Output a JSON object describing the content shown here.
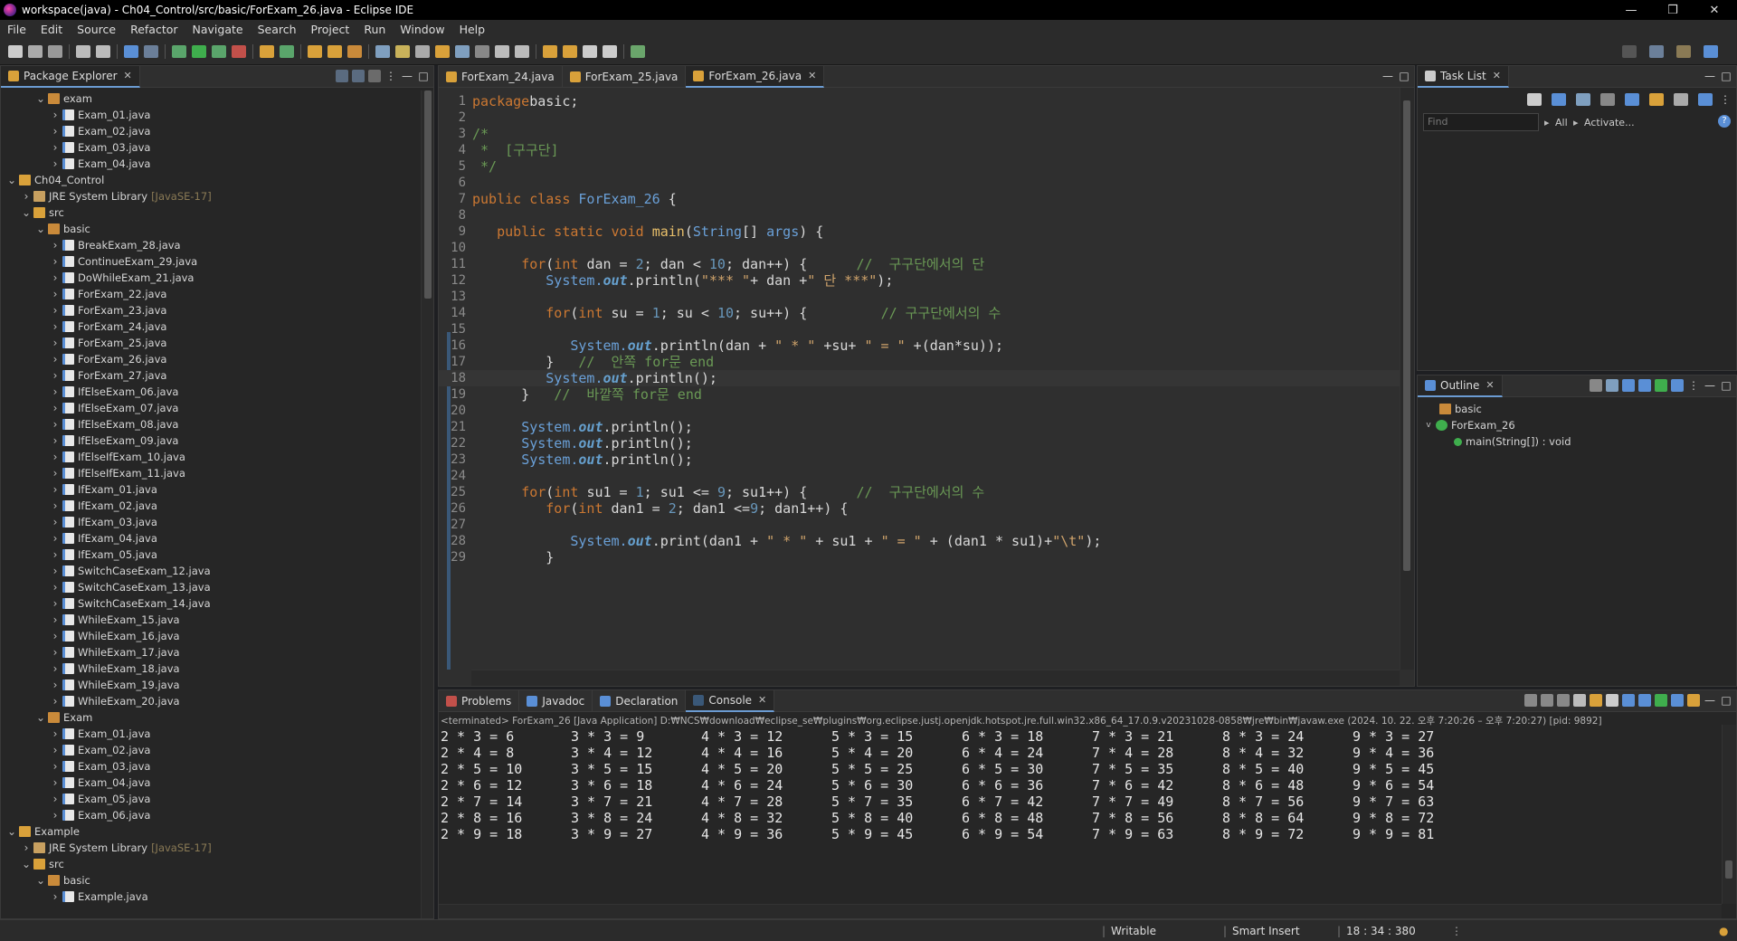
{
  "window": {
    "title": "workspace(java) - Ch04_Control/src/basic/ForExam_26.java - Eclipse IDE"
  },
  "menu": [
    "File",
    "Edit",
    "Source",
    "Refactor",
    "Navigate",
    "Search",
    "Project",
    "Run",
    "Window",
    "Help"
  ],
  "package_explorer": {
    "title": "Package Explorer",
    "rows": [
      {
        "d": 2,
        "ch": "v",
        "i": "pkg",
        "t": "exam"
      },
      {
        "d": 3,
        "ch": ">",
        "i": "java",
        "t": "Exam_01.java"
      },
      {
        "d": 3,
        "ch": ">",
        "i": "java",
        "t": "Exam_02.java"
      },
      {
        "d": 3,
        "ch": ">",
        "i": "java",
        "t": "Exam_03.java"
      },
      {
        "d": 3,
        "ch": ">",
        "i": "java",
        "t": "Exam_04.java"
      },
      {
        "d": 0,
        "ch": "v",
        "i": "proj",
        "t": "Ch04_Control"
      },
      {
        "d": 1,
        "ch": ">",
        "i": "jre",
        "t": "JRE System Library",
        "dec": "[JavaSE-17]"
      },
      {
        "d": 1,
        "ch": "v",
        "i": "src",
        "t": "src"
      },
      {
        "d": 2,
        "ch": "v",
        "i": "pkg",
        "t": "basic"
      },
      {
        "d": 3,
        "ch": ">",
        "i": "java",
        "t": "BreakExam_28.java"
      },
      {
        "d": 3,
        "ch": ">",
        "i": "java",
        "t": "ContinueExam_29.java"
      },
      {
        "d": 3,
        "ch": ">",
        "i": "java",
        "t": "DoWhileExam_21.java"
      },
      {
        "d": 3,
        "ch": ">",
        "i": "java",
        "t": "ForExam_22.java"
      },
      {
        "d": 3,
        "ch": ">",
        "i": "java",
        "t": "ForExam_23.java"
      },
      {
        "d": 3,
        "ch": ">",
        "i": "java",
        "t": "ForExam_24.java"
      },
      {
        "d": 3,
        "ch": ">",
        "i": "java",
        "t": "ForExam_25.java"
      },
      {
        "d": 3,
        "ch": ">",
        "i": "java",
        "t": "ForExam_26.java"
      },
      {
        "d": 3,
        "ch": ">",
        "i": "java",
        "t": "ForExam_27.java"
      },
      {
        "d": 3,
        "ch": ">",
        "i": "java",
        "t": "IfElseExam_06.java"
      },
      {
        "d": 3,
        "ch": ">",
        "i": "java",
        "t": "IfElseExam_07.java"
      },
      {
        "d": 3,
        "ch": ">",
        "i": "java",
        "t": "IfElseExam_08.java"
      },
      {
        "d": 3,
        "ch": ">",
        "i": "java",
        "t": "IfElseExam_09.java"
      },
      {
        "d": 3,
        "ch": ">",
        "i": "java",
        "t": "IfElseIfExam_10.java"
      },
      {
        "d": 3,
        "ch": ">",
        "i": "java",
        "t": "IfElseIfExam_11.java"
      },
      {
        "d": 3,
        "ch": ">",
        "i": "java",
        "t": "IfExam_01.java"
      },
      {
        "d": 3,
        "ch": ">",
        "i": "java",
        "t": "IfExam_02.java"
      },
      {
        "d": 3,
        "ch": ">",
        "i": "java",
        "t": "IfExam_03.java"
      },
      {
        "d": 3,
        "ch": ">",
        "i": "java",
        "t": "IfExam_04.java"
      },
      {
        "d": 3,
        "ch": ">",
        "i": "java",
        "t": "IfExam_05.java"
      },
      {
        "d": 3,
        "ch": ">",
        "i": "java",
        "t": "SwitchCaseExam_12.java"
      },
      {
        "d": 3,
        "ch": ">",
        "i": "java",
        "t": "SwitchCaseExam_13.java"
      },
      {
        "d": 3,
        "ch": ">",
        "i": "java",
        "t": "SwitchCaseExam_14.java"
      },
      {
        "d": 3,
        "ch": ">",
        "i": "java",
        "t": "WhileExam_15.java"
      },
      {
        "d": 3,
        "ch": ">",
        "i": "java",
        "t": "WhileExam_16.java"
      },
      {
        "d": 3,
        "ch": ">",
        "i": "java",
        "t": "WhileExam_17.java"
      },
      {
        "d": 3,
        "ch": ">",
        "i": "java",
        "t": "WhileExam_18.java"
      },
      {
        "d": 3,
        "ch": ">",
        "i": "java",
        "t": "WhileExam_19.java"
      },
      {
        "d": 3,
        "ch": ">",
        "i": "java",
        "t": "WhileExam_20.java"
      },
      {
        "d": 2,
        "ch": "v",
        "i": "pkg",
        "t": "Exam"
      },
      {
        "d": 3,
        "ch": ">",
        "i": "java",
        "t": "Exam_01.java"
      },
      {
        "d": 3,
        "ch": ">",
        "i": "java",
        "t": "Exam_02.java"
      },
      {
        "d": 3,
        "ch": ">",
        "i": "java",
        "t": "Exam_03.java"
      },
      {
        "d": 3,
        "ch": ">",
        "i": "java",
        "t": "Exam_04.java"
      },
      {
        "d": 3,
        "ch": ">",
        "i": "java",
        "t": "Exam_05.java"
      },
      {
        "d": 3,
        "ch": ">",
        "i": "java",
        "t": "Exam_06.java"
      },
      {
        "d": 0,
        "ch": "v",
        "i": "proj",
        "t": "Example"
      },
      {
        "d": 1,
        "ch": ">",
        "i": "jre",
        "t": "JRE System Library",
        "dec": "[JavaSE-17]"
      },
      {
        "d": 1,
        "ch": "v",
        "i": "src",
        "t": "src"
      },
      {
        "d": 2,
        "ch": "v",
        "i": "pkg",
        "t": "basic"
      },
      {
        "d": 3,
        "ch": ">",
        "i": "java",
        "t": "Example.java"
      }
    ]
  },
  "editor": {
    "tabs": [
      {
        "label": "ForExam_24.java",
        "active": false
      },
      {
        "label": "ForExam_25.java",
        "active": false
      },
      {
        "label": "ForExam_26.java",
        "active": true
      }
    ],
    "lines": [
      [
        [
          "kw",
          "package"
        ],
        [
          "",
          "basic;"
        ]
      ],
      [],
      [
        [
          "cmt",
          "/*"
        ]
      ],
      [
        [
          "cmt",
          " *  [구구단]"
        ]
      ],
      [
        [
          "cmt",
          " */"
        ]
      ],
      [],
      [
        [
          "kw",
          "public class "
        ],
        [
          "typ",
          "ForExam_26"
        ],
        [
          "",
          " {"
        ]
      ],
      [],
      [
        [
          "",
          "   "
        ],
        [
          "kw",
          "public static void "
        ],
        [
          "mth",
          "main"
        ],
        [
          "",
          "("
        ],
        [
          "typ",
          "String"
        ],
        [
          "",
          "[] "
        ],
        [
          "typ",
          "args"
        ],
        [
          "",
          ") {"
        ]
      ],
      [],
      [
        [
          "",
          "      "
        ],
        [
          "kw",
          "for"
        ],
        [
          "",
          "("
        ],
        [
          "kw",
          "int "
        ],
        [
          "",
          "dan = "
        ],
        [
          "num",
          "2"
        ],
        [
          "",
          "; dan < "
        ],
        [
          "num",
          "10"
        ],
        [
          "",
          "; dan++) {      "
        ],
        [
          "cmt",
          "//  구구단에서의 단"
        ]
      ],
      [
        [
          "",
          "         "
        ],
        [
          "sysc",
          "System."
        ],
        [
          "fld",
          "out"
        ],
        [
          "",
          ".println("
        ],
        [
          "str",
          "\"*** \""
        ],
        [
          "",
          "+ dan +"
        ],
        [
          "str",
          "\" 단 ***\""
        ],
        [
          "",
          ");"
        ]
      ],
      [],
      [
        [
          "",
          "         "
        ],
        [
          "kw",
          "for"
        ],
        [
          "",
          "("
        ],
        [
          "kw",
          "int "
        ],
        [
          "",
          "su = "
        ],
        [
          "num",
          "1"
        ],
        [
          "",
          "; su < "
        ],
        [
          "num",
          "10"
        ],
        [
          "",
          "; su++) {         "
        ],
        [
          "cmt",
          "// 구구단에서의 수"
        ]
      ],
      [],
      [
        [
          "",
          "            "
        ],
        [
          "sysc",
          "System."
        ],
        [
          "fld",
          "out"
        ],
        [
          "",
          ".println(dan + "
        ],
        [
          "str",
          "\" * \""
        ],
        [
          "",
          " +su+ "
        ],
        [
          "str",
          "\" = \""
        ],
        [
          "",
          " +(dan*su));"
        ]
      ],
      [
        [
          "",
          "         }   "
        ],
        [
          "cmt",
          "//  안쪽 for문 end"
        ]
      ],
      [
        [
          "",
          "         "
        ],
        [
          "sysc",
          "System."
        ],
        [
          "fld",
          "out"
        ],
        [
          "",
          ".println();"
        ]
      ],
      [
        [
          "",
          "      }   "
        ],
        [
          "cmt",
          "//  바깥쪽 for문 end"
        ]
      ],
      [],
      [
        [
          "",
          "      "
        ],
        [
          "sysc",
          "System."
        ],
        [
          "fld",
          "out"
        ],
        [
          "",
          ".println();"
        ]
      ],
      [
        [
          "",
          "      "
        ],
        [
          "sysc",
          "System."
        ],
        [
          "fld",
          "out"
        ],
        [
          "",
          ".println();"
        ]
      ],
      [
        [
          "",
          "      "
        ],
        [
          "sysc",
          "System."
        ],
        [
          "fld",
          "out"
        ],
        [
          "",
          ".println();"
        ]
      ],
      [],
      [
        [
          "",
          "      "
        ],
        [
          "kw",
          "for"
        ],
        [
          "",
          "("
        ],
        [
          "kw",
          "int "
        ],
        [
          "",
          "su1 = "
        ],
        [
          "num",
          "1"
        ],
        [
          "",
          "; su1 <= "
        ],
        [
          "num",
          "9"
        ],
        [
          "",
          "; su1++) {      "
        ],
        [
          "cmt",
          "//  구구단에서의 수"
        ]
      ],
      [
        [
          "",
          "         "
        ],
        [
          "kw",
          "for"
        ],
        [
          "",
          "("
        ],
        [
          "kw",
          "int "
        ],
        [
          "",
          "dan1 = "
        ],
        [
          "num",
          "2"
        ],
        [
          "",
          "; dan1 <="
        ],
        [
          "num",
          "9"
        ],
        [
          "",
          "; dan1++) {"
        ]
      ],
      [],
      [
        [
          "",
          "            "
        ],
        [
          "sysc",
          "System."
        ],
        [
          "fld",
          "out"
        ],
        [
          "",
          ".print(dan1 + "
        ],
        [
          "str",
          "\" * \""
        ],
        [
          "",
          " + su1 + "
        ],
        [
          "str",
          "\" = \""
        ],
        [
          "",
          " + (dan1 * su1)+"
        ],
        [
          "str",
          "\"\\t\""
        ],
        [
          "",
          ");"
        ]
      ],
      [
        [
          "",
          "         }"
        ]
      ]
    ]
  },
  "task_list": {
    "title": "Task List",
    "find_placeholder": "Find",
    "all_label": "All",
    "activate_label": "Activate..."
  },
  "outline": {
    "title": "Outline",
    "items": [
      "basic",
      "ForExam_26",
      "main(String[]) : void"
    ]
  },
  "bottom_tabs": [
    {
      "label": "Problems",
      "active": false
    },
    {
      "label": "Javadoc",
      "active": false
    },
    {
      "label": "Declaration",
      "active": false
    },
    {
      "label": "Console",
      "active": true
    }
  ],
  "console": {
    "terminated": "<terminated> ForExam_26 [Java Application] D:₩NCS₩download₩eclipse_se₩plugins₩org.eclipse.justj.openjdk.hotspot.jre.full.win32.x86_64_17.0.9.v20231028-0858₩jre₩bin₩javaw.exe  (2024. 10. 22. 오후 7:20:26 – 오후 7:20:27) [pid: 9892]",
    "rows": [
      [
        "2 * 3 = 6",
        "3 * 3 = 9",
        "4 * 3 = 12",
        "5 * 3 = 15",
        "6 * 3 = 18",
        "7 * 3 = 21",
        "8 * 3 = 24",
        "9 * 3 = 27"
      ],
      [
        "2 * 4 = 8",
        "3 * 4 = 12",
        "4 * 4 = 16",
        "5 * 4 = 20",
        "6 * 4 = 24",
        "7 * 4 = 28",
        "8 * 4 = 32",
        "9 * 4 = 36"
      ],
      [
        "2 * 5 = 10",
        "3 * 5 = 15",
        "4 * 5 = 20",
        "5 * 5 = 25",
        "6 * 5 = 30",
        "7 * 5 = 35",
        "8 * 5 = 40",
        "9 * 5 = 45"
      ],
      [
        "2 * 6 = 12",
        "3 * 6 = 18",
        "4 * 6 = 24",
        "5 * 6 = 30",
        "6 * 6 = 36",
        "7 * 6 = 42",
        "8 * 6 = 48",
        "9 * 6 = 54"
      ],
      [
        "2 * 7 = 14",
        "3 * 7 = 21",
        "4 * 7 = 28",
        "5 * 7 = 35",
        "6 * 7 = 42",
        "7 * 7 = 49",
        "8 * 7 = 56",
        "9 * 7 = 63"
      ],
      [
        "2 * 8 = 16",
        "3 * 8 = 24",
        "4 * 8 = 32",
        "5 * 8 = 40",
        "6 * 8 = 48",
        "7 * 8 = 56",
        "8 * 8 = 64",
        "9 * 8 = 72"
      ],
      [
        "2 * 9 = 18",
        "3 * 9 = 27",
        "4 * 9 = 36",
        "5 * 9 = 45",
        "6 * 9 = 54",
        "7 * 9 = 63",
        "8 * 9 = 72",
        "9 * 9 = 81"
      ]
    ]
  },
  "status": {
    "writable": "Writable",
    "insert_mode": "Smart Insert",
    "position": "18 : 34 : 380"
  },
  "colors": {
    "accent": "#6b9bd2",
    "keyword": "#cc7832",
    "string": "#cfa36b",
    "comment": "#6a9955"
  }
}
